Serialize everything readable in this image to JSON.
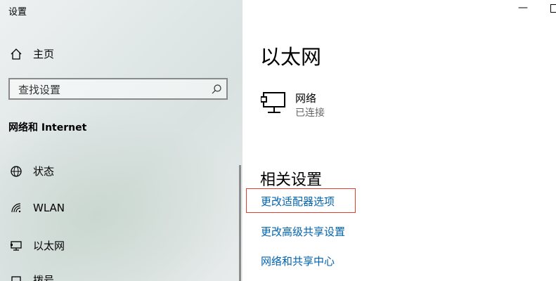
{
  "window": {
    "title": "设置",
    "minimize_glyph": "—"
  },
  "sidebar": {
    "home_label": "主页",
    "home_icon": "home-icon",
    "search_placeholder": "查找设置",
    "section_heading": "网络和 Internet",
    "items": [
      {
        "label": "状态",
        "icon": "globe-icon"
      },
      {
        "label": "WLAN",
        "icon": "wifi-icon"
      },
      {
        "label": "以太网",
        "icon": "ethernet-icon"
      },
      {
        "label": "拨号",
        "icon": "dialup-icon"
      }
    ]
  },
  "main": {
    "title": "以太网",
    "network": {
      "name": "网络",
      "status": "已连接",
      "icon": "ethernet-computer-icon"
    },
    "related_heading": "相关设置",
    "links": [
      "更改适配器选项",
      "更改高级共享设置",
      "网络和共享中心"
    ]
  },
  "colors": {
    "link": "#0063b1",
    "highlight": "#e04030"
  }
}
